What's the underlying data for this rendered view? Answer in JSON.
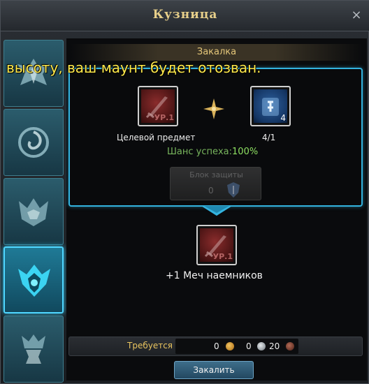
{
  "window": {
    "title": "Кузница",
    "close_label": "×"
  },
  "section": {
    "title": "Закалка"
  },
  "overlay": {
    "text": "высоту, ваш маунт будет отозван."
  },
  "target_item": {
    "label": "Целевой предмет",
    "level": "УР.1"
  },
  "material": {
    "count": "4/1",
    "stack": "4"
  },
  "chance": {
    "label": "Шанс успеха:",
    "value": "100%"
  },
  "protection": {
    "label": "Блок защиты",
    "count": "0"
  },
  "result": {
    "name": "+1 Меч наемников",
    "level": "УР.1"
  },
  "requirements": {
    "label": "Требуется",
    "gold": "0",
    "silver": "0",
    "bronze": "20",
    "colors": {
      "gold": "#d4901e",
      "silver": "#aeb4ba",
      "bronze": "#7a3b2c"
    }
  },
  "action": {
    "label": "Закалить"
  },
  "sidebar": {
    "tabs": [
      {
        "icon": "eagle-icon",
        "active": false
      },
      {
        "icon": "swirl-orb-icon",
        "active": false
      },
      {
        "icon": "horned-helm-icon",
        "active": false
      },
      {
        "icon": "shield-spikes-icon",
        "active": true
      },
      {
        "icon": "anvil-icon",
        "active": false
      }
    ]
  },
  "colors": {
    "accent": "#33b3df",
    "gold_text": "#e5c77a",
    "chance_value": "#8ee062",
    "overlay_text": "#ffe94a"
  }
}
